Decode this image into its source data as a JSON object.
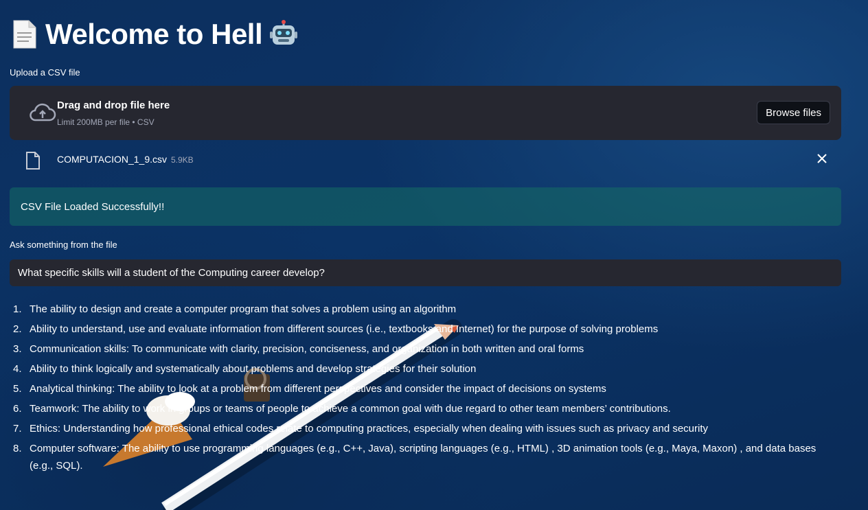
{
  "header": {
    "title": "Welcome to Hell",
    "left_icon": "page-facing-up-emoji",
    "right_icon": "robot-face-emoji"
  },
  "uploader": {
    "label": "Upload a CSV file",
    "drag_text": "Drag and drop file here",
    "limit_text": "Limit 200MB per file • CSV",
    "browse_label": "Browse files",
    "icon": "cloud-upload-icon"
  },
  "uploaded_file": {
    "name": "COMPUTACION_1_9.csv",
    "size": "5.9KB",
    "icon": "file-icon"
  },
  "status": {
    "message": "CSV File Loaded Successfully!!",
    "color": "#166e64"
  },
  "question": {
    "label": "Ask something from the file",
    "value": "What specific skills will a student of the Computing career develop?"
  },
  "answers": [
    {
      "num": "1.",
      "text": "The ability to design and create a computer program that solves a problem using an algorithm"
    },
    {
      "num": "2.",
      "text": "Ability to understand, use and evaluate information from different sources (i.e., textbooks and Internet) for the purpose of solving problems"
    },
    {
      "num": "3.",
      "text": "Communication skills: To communicate with clarity, precision, conciseness, and organization in both written and oral forms"
    },
    {
      "num": "4.",
      "text": "Ability to think logically and systematically about problems and develop strategies for their solution"
    },
    {
      "num": "5.",
      "text": "Analytical thinking: The ability to look at a problem from different perspectives and consider the impact of decisions on systems"
    },
    {
      "num": "6.",
      "text": "Teamwork: The ability to work in groups or teams of people to achieve a common goal with due regard to other team members’ contributions."
    },
    {
      "num": "7.",
      "text": "Ethics: Understanding how professional ethical codes relate to computing practices, especially when dealing with issues such as privacy and security"
    },
    {
      "num": "8.",
      "text": "Computer software: The ability to use programming languages (e.g., C++, Java), scripting languages (e.g., HTML) , 3D animation tools (e.g., Maya, Maxon) , and data bases (e.g., SQL)."
    }
  ],
  "colors": {
    "background": "#0b3366",
    "panel": "#262730",
    "text": "#ffffff",
    "muted": "#a3a8b8"
  }
}
